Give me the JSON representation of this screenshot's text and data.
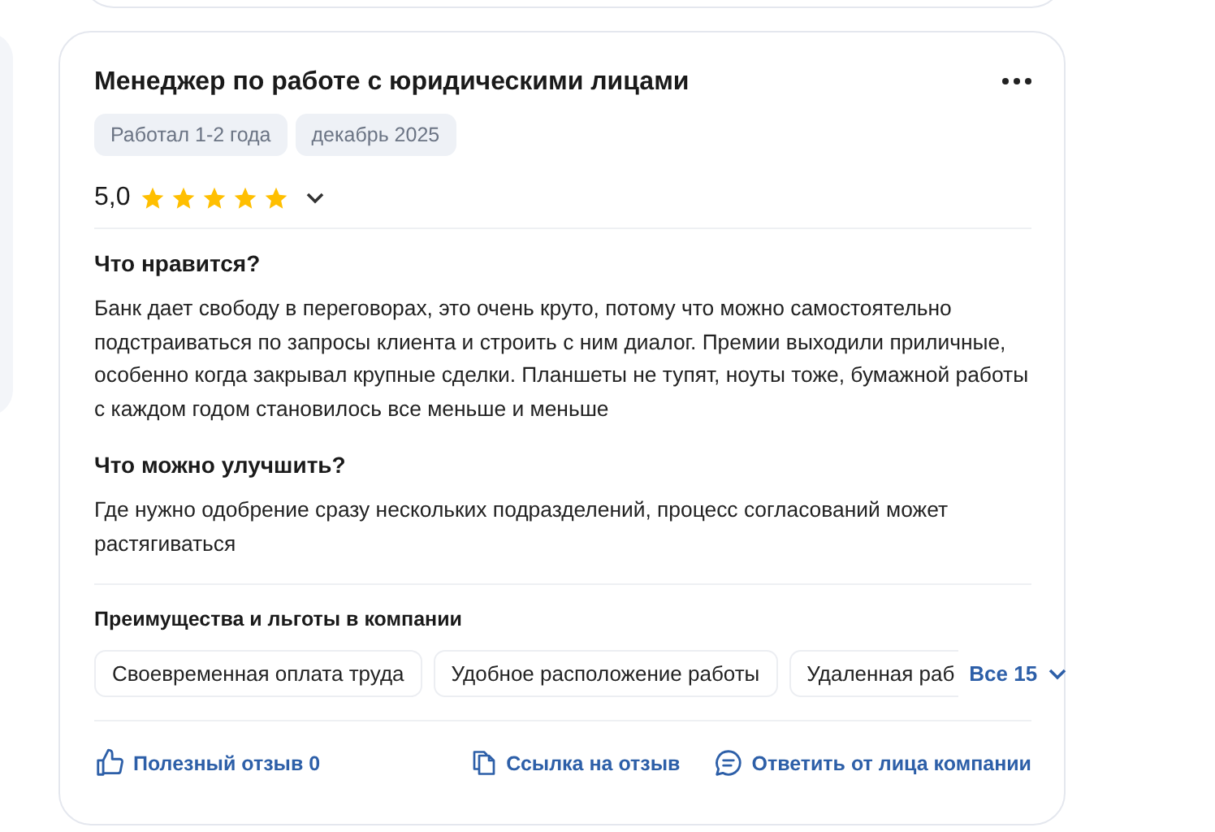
{
  "review": {
    "title": "Менеджер по работе с юридическими лицами",
    "tags": [
      "Работал 1-2 года",
      "декабрь 2025"
    ],
    "rating": {
      "value": "5,0",
      "stars": 5
    },
    "sections": [
      {
        "heading": "Что нравится?",
        "text": "Банк дает свободу в переговорах, это очень круто, потому что можно самостоятельно подстраиваться по запросы клиента и строить с ним диалог. Премии выходили приличные, особенно когда закрывал крупные сделки. Планшеты не тупят, ноуты тоже, бумажной работы с каждом годом становилось все меньше и меньше"
      },
      {
        "heading": "Что можно улучшить?",
        "text": "Где нужно одобрение сразу нескольких подразделений, процесс согласований может растягиваться"
      }
    ],
    "benefits": {
      "heading": "Преимущества и льготы в компании",
      "items": [
        "Своевременная оплата труда",
        "Удобное расположение работы",
        "Удаленная раб"
      ],
      "more": "Все 15"
    },
    "actions": [
      {
        "kind": "like",
        "label": "Полезный отзыв 0"
      },
      {
        "kind": "link",
        "label": "Ссылка на отзыв"
      },
      {
        "kind": "reply",
        "label": "Ответить от лица компании"
      }
    ]
  }
}
